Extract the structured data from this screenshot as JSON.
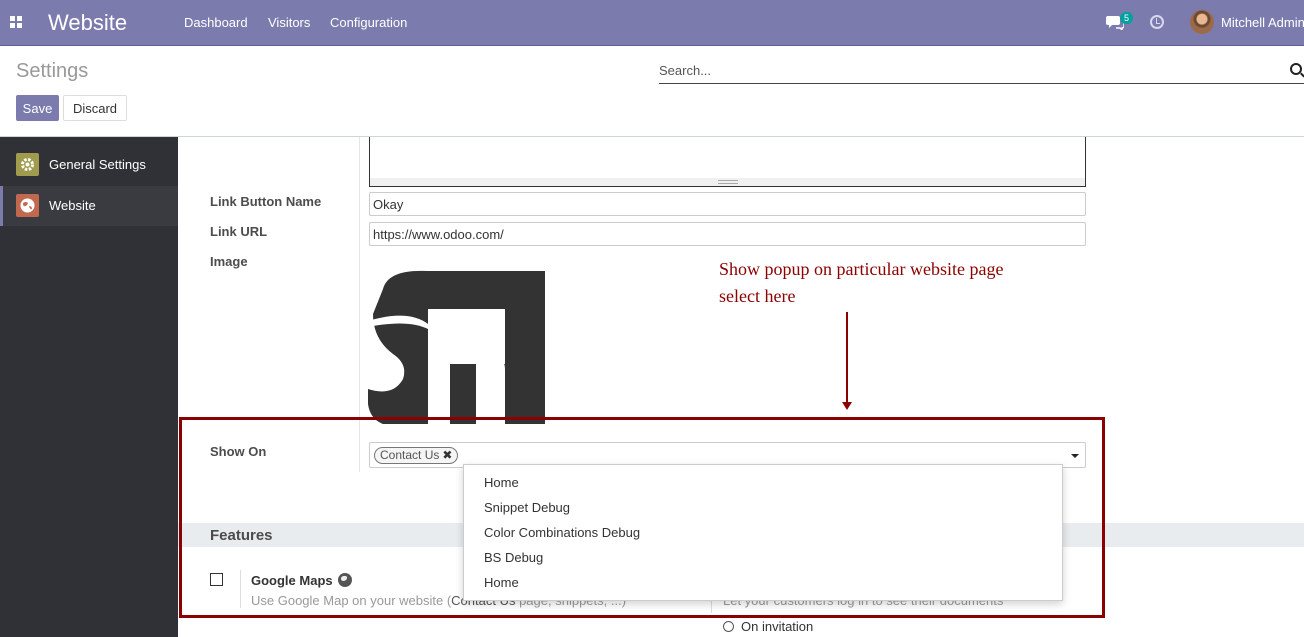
{
  "navbar": {
    "app_name": "Website",
    "menu": [
      "Dashboard",
      "Visitors",
      "Configuration"
    ],
    "chat_badge": "5",
    "user_name": "Mitchell Admin",
    "color": "#7c7bad"
  },
  "control_panel": {
    "title": "Settings",
    "search_placeholder": "Search...",
    "save_label": "Save",
    "discard_label": "Discard"
  },
  "sidebar": {
    "items": [
      {
        "label": "General Settings",
        "icon": "gear-icon",
        "color": "#a09b4d"
      },
      {
        "label": "Website",
        "icon": "globe-icon",
        "color": "#c1694f",
        "active": true
      }
    ]
  },
  "form": {
    "link_button_name_label": "Link Button Name",
    "link_button_name_value": "Okay",
    "link_url_label": "Link URL",
    "link_url_value": "https://www.odoo.com/",
    "image_label": "Image",
    "show_on_label": "Show On",
    "show_on_tag": "Contact Us"
  },
  "annotation": {
    "line1": "Show popup on particular website page",
    "line2": "select here",
    "color": "#8b0000"
  },
  "dropdown": {
    "options": [
      "Home",
      "Snippet Debug",
      "Color Combinations Debug",
      "BS Debug",
      "Home"
    ]
  },
  "features": {
    "title": "Features",
    "google_maps_title": "Google Maps",
    "google_maps_desc_start": "Use Google Map on your website (",
    "google_maps_desc_link": "Contact Us",
    "google_maps_desc_end": " page, snippets, ...)",
    "portal_desc": "Let your customers log in to see their documents",
    "radio_label": "On invitation"
  }
}
